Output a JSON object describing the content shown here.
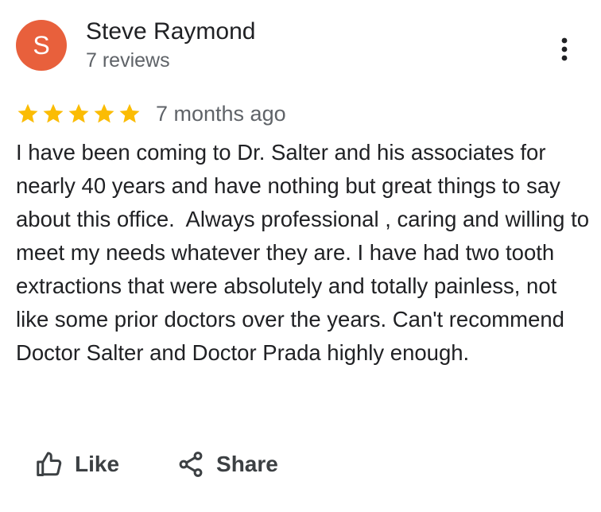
{
  "reviewer": {
    "initial": "S",
    "name": "Steve Raymond",
    "review_count": "7 reviews",
    "avatar_color": "#e8603c"
  },
  "review": {
    "rating": 5,
    "max_rating": 5,
    "star_color": "#fbbc04",
    "date": "7 months ago",
    "text": "I have been coming to Dr. Salter and his associates for nearly 40 years and have nothing but great things to say about this office.  Always professional , caring and willing to meet my needs whatever they are. I have had two tooth extractions that were absolutely and totally painless, not like some prior doctors over the years. Can't recommend Doctor Salter and Doctor Prada highly enough."
  },
  "actions": {
    "like_label": "Like",
    "share_label": "Share"
  },
  "icons": {
    "more": "more-vert-icon",
    "star": "star-icon",
    "like": "thumb-up-icon",
    "share": "share-icon"
  }
}
